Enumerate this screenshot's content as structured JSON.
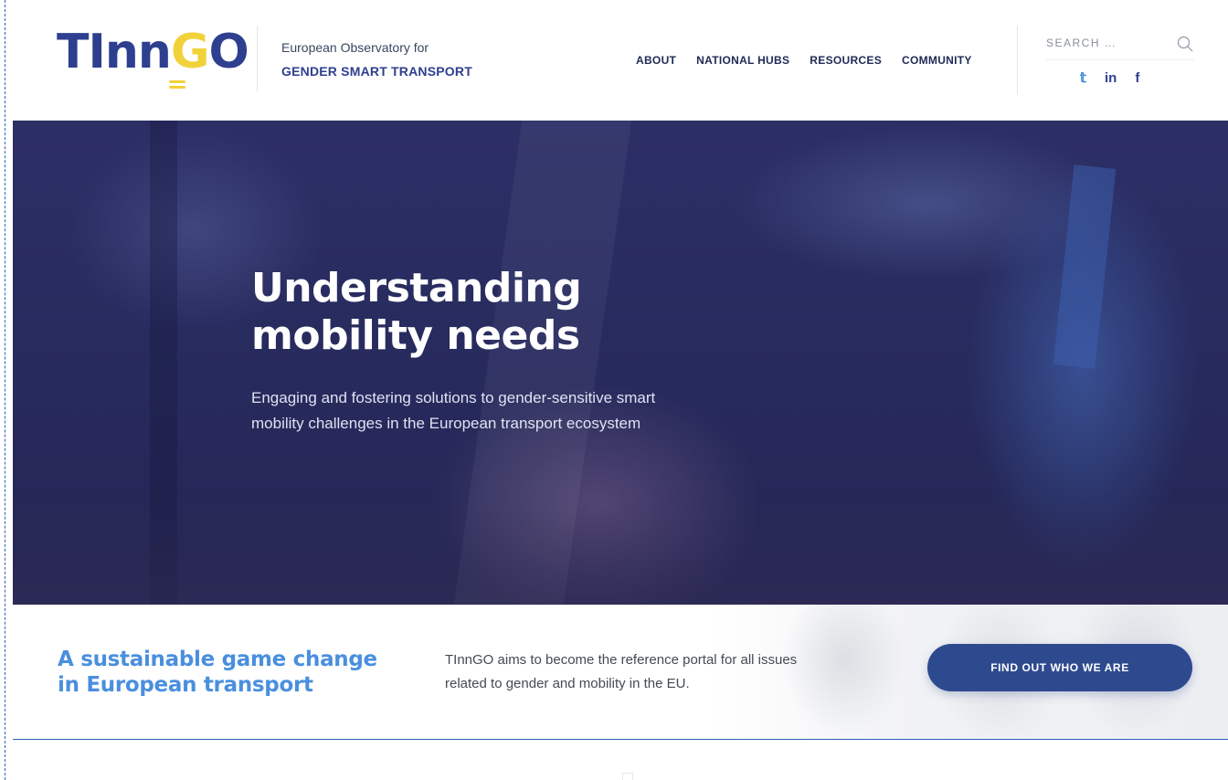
{
  "header": {
    "logo": {
      "text_part1": "TInn",
      "text_g": "G",
      "text_part2": "O"
    },
    "tagline_line1": "European Observatory for",
    "tagline_line2": "GENDER SMART TRANSPORT",
    "nav": [
      {
        "label": "ABOUT"
      },
      {
        "label": "NATIONAL HUBS"
      },
      {
        "label": "RESOURCES"
      },
      {
        "label": "COMMUNITY"
      }
    ],
    "search": {
      "placeholder": "SEARCH …",
      "icon": "search-icon"
    },
    "social": [
      {
        "label": "𝕥",
        "icon": "twitter-icon"
      },
      {
        "label": "in",
        "icon": "linkedin-icon"
      },
      {
        "label": "f",
        "icon": "facebook-icon"
      }
    ]
  },
  "hero": {
    "title_line1": "Understanding",
    "title_line2": "mobility needs",
    "subtitle": "Engaging and fostering solutions to gender-sensitive smart mobility challenges in the European transport ecosystem"
  },
  "band": {
    "title_line1": "A sustainable game change",
    "title_line2": "in European transport",
    "text": "TInnGO aims to become the reference portal for all issues related to gender and mobility in the EU.",
    "cta_label": "FIND OUT WHO WE ARE"
  },
  "colors": {
    "brand_navy": "#2e3f8f",
    "brand_yellow": "#f2d23a",
    "accent_blue": "#4a8fde",
    "cta_bg": "#2e4a8f",
    "hero_bg": "#2a2d62"
  }
}
